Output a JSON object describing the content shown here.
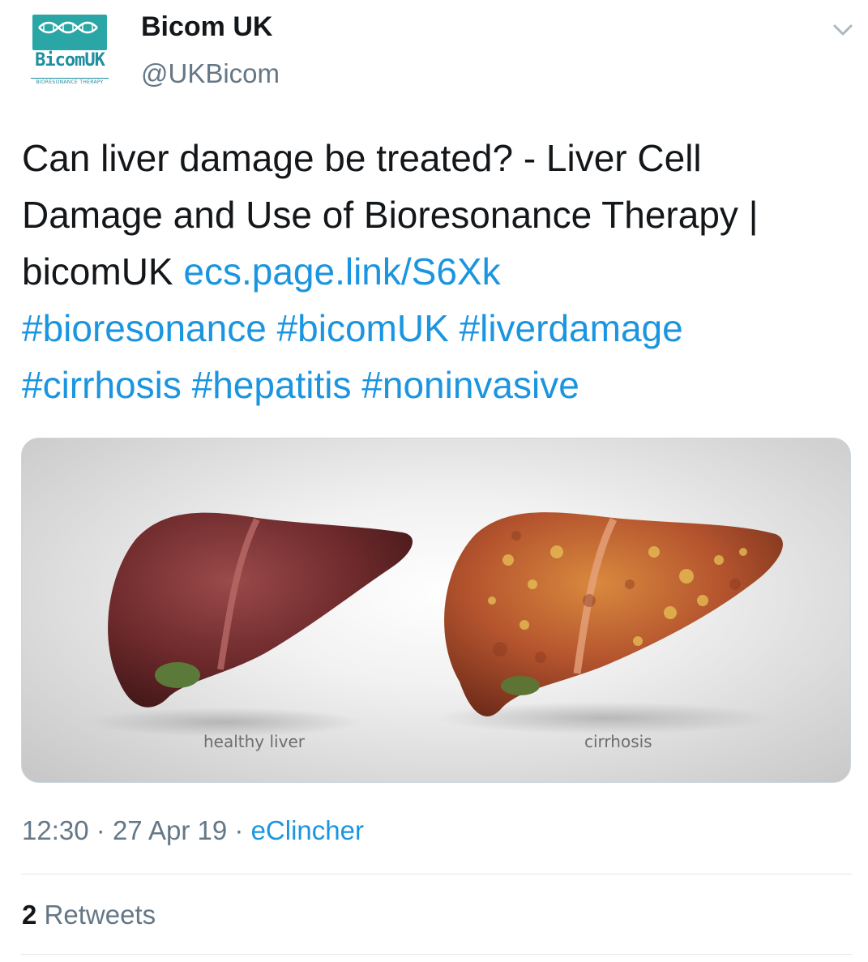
{
  "tweet": {
    "author_name": "Bicom UK",
    "author_handle": "@UKBicom",
    "avatar": {
      "brand_text": "BicomUK",
      "sub_text": "BIORESONANCE THERAPY",
      "icon": "dna-logo-icon",
      "color": "#2aa6a6"
    },
    "text": "Can liver damage be treated? - Liver Cell Damage and Use of Bioresonance Therapy | bicomUK ",
    "link": "ecs.page.link/S6Xk",
    "hashtags_line1": "#bioresonance #bicomUK #liverdamage",
    "hashtags_line2": "#cirrhosis #hepatitis #noninvasive",
    "media": {
      "caption_left": "healthy liver",
      "caption_right": "cirrhosis"
    },
    "time": "12:30",
    "date": "27 Apr 19",
    "separator": "·",
    "source": "eClincher",
    "retweet_count": "2",
    "retweet_label": "Retweets"
  },
  "colors": {
    "link": "#1b95e0",
    "secondary_text": "#657786",
    "primary_text": "#14171a"
  }
}
